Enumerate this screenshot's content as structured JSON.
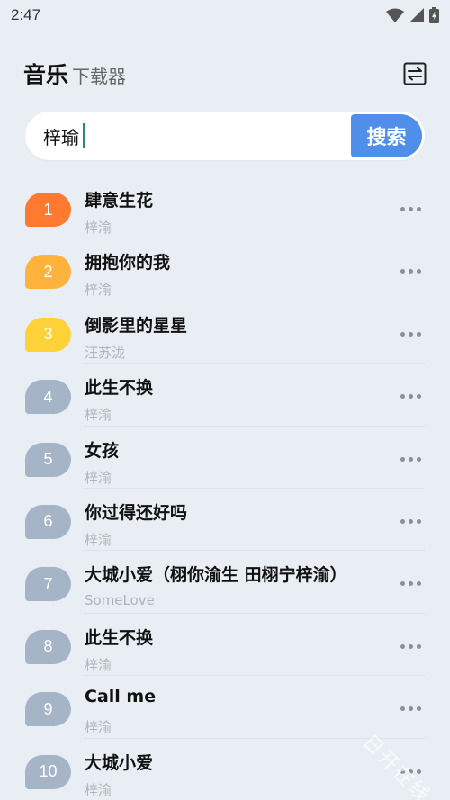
{
  "status_bar": {
    "time": "2:47"
  },
  "header": {
    "title_main": "音乐",
    "title_sub": "下载器",
    "switch_icon": "swap-icon"
  },
  "search": {
    "value": "梓瑜",
    "button_label": "搜索"
  },
  "colors": {
    "accent": "#4f8fea",
    "rank1": "#ff7a2f",
    "rank2": "#ffb33c",
    "rank3": "#ffd23a",
    "rank_default": "#a6b4c8",
    "background": "#e8eef3"
  },
  "songs": [
    {
      "rank": "1",
      "title": "肆意生花",
      "artist": "梓渝"
    },
    {
      "rank": "2",
      "title": "拥抱你的我",
      "artist": "梓渝"
    },
    {
      "rank": "3",
      "title": "倒影里的星星",
      "artist": "汪苏泷"
    },
    {
      "rank": "4",
      "title": "此生不换",
      "artist": "梓渝"
    },
    {
      "rank": "5",
      "title": "女孩",
      "artist": "梓渝"
    },
    {
      "rank": "6",
      "title": "你过得还好吗",
      "artist": "梓渝"
    },
    {
      "rank": "7",
      "title": "大城小爱（栩你渝生  田栩宁梓渝）",
      "artist": "SomeLove"
    },
    {
      "rank": "8",
      "title": "此生不换",
      "artist": "梓渝"
    },
    {
      "rank": "9",
      "title": "Call me",
      "artist": "梓渝"
    },
    {
      "rank": "10",
      "title": "大城小爱",
      "artist": "梓渝"
    }
  ],
  "watermark": "日开在线"
}
